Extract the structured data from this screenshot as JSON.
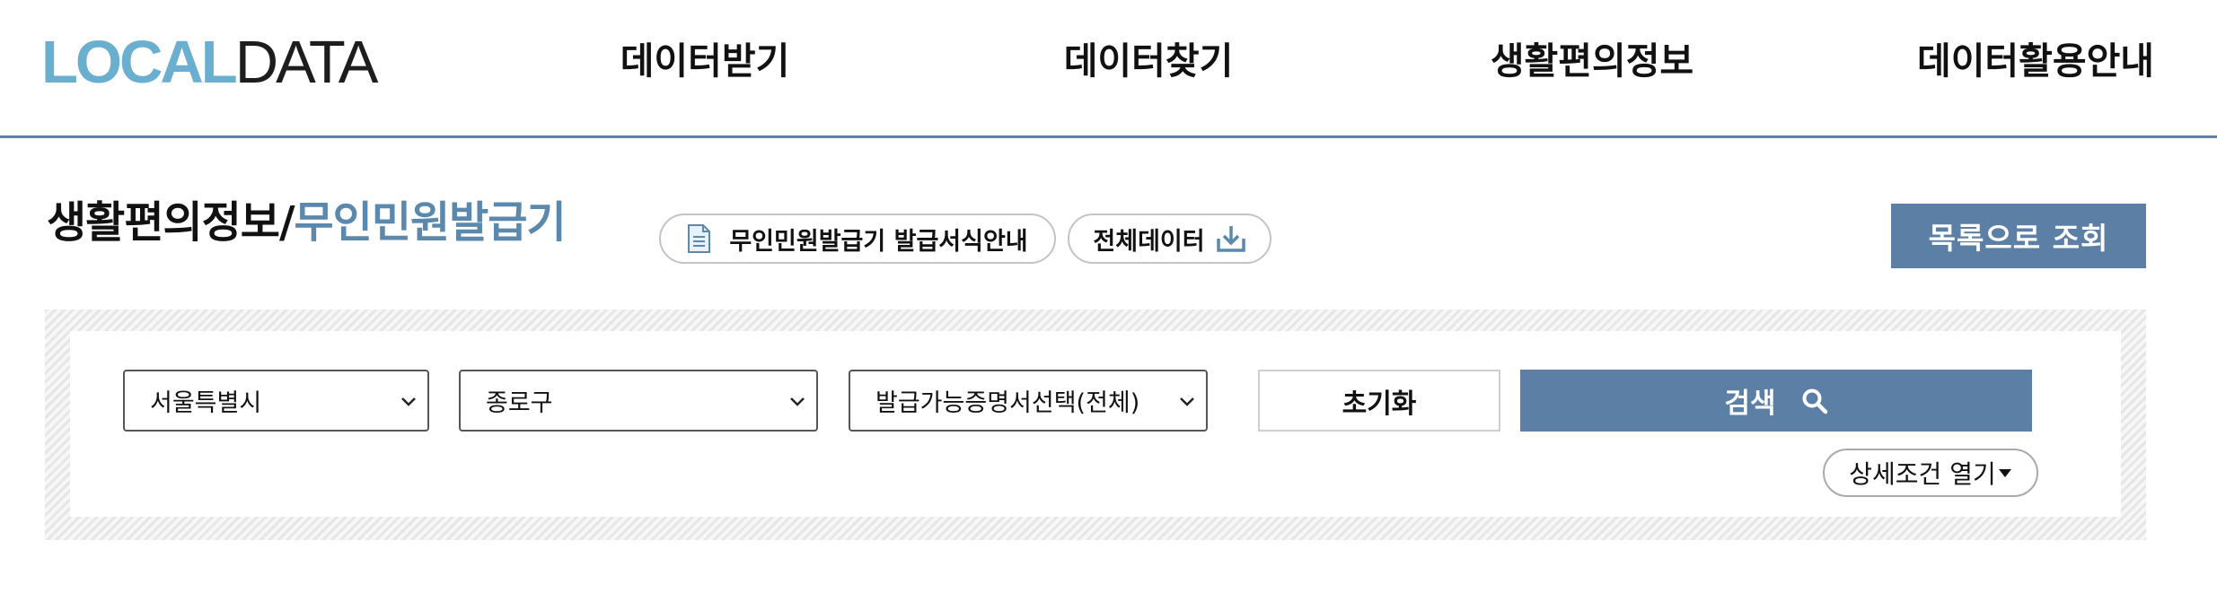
{
  "header": {
    "logo": {
      "part1": "LOCAL",
      "part2": "DATA"
    },
    "nav": [
      {
        "label": "데이터받기"
      },
      {
        "label": "데이터찾기"
      },
      {
        "label": "생활편의정보"
      },
      {
        "label": "데이터활용안내"
      }
    ]
  },
  "page": {
    "title_category": "생활편의정보",
    "title_separator": "/",
    "title_sub": "무인민원발급기",
    "guide_button_label": "무인민원발급기 발급서식안내",
    "all_data_button_label": "전체데이터",
    "list_button_label": "목록으로 조회"
  },
  "search": {
    "city_select": "서울특별시",
    "district_select": "종로구",
    "certificate_select": "발급가능증명서선택(전체)",
    "reset_label": "초기화",
    "search_label": "검색",
    "detail_toggle_label": "상세조건 열기"
  },
  "colors": {
    "accent": "#5b7fa5",
    "logo_light": "#6aaed0",
    "title_highlight": "#5b88ad"
  },
  "icons": {
    "guide": "document-icon",
    "all_data": "download-icon",
    "search": "search-icon",
    "select": "chevron-down-icon",
    "detail": "caret-down-icon"
  }
}
